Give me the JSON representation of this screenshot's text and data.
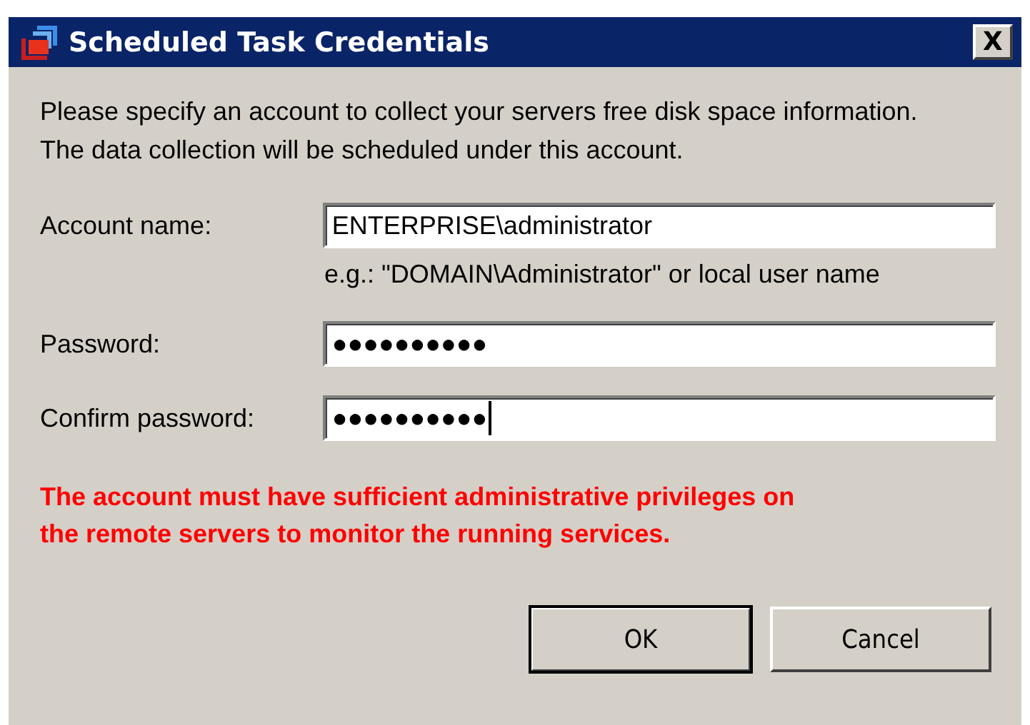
{
  "window": {
    "title": "Scheduled Task Credentials",
    "close": "X"
  },
  "intro": "Please specify an account to collect your servers free disk space information. The data collection will be scheduled under this account.",
  "fields": [
    {
      "label": "Account name:",
      "value": "ENTERPRISE\\administrator",
      "focused": false,
      "hint": "e.g.: \"DOMAIN\\Administrator\" or local user name"
    },
    {
      "label": "Password:",
      "value": "●●●●●●●●●●",
      "focused": false
    },
    {
      "label": "Confirm password:",
      "value": "●●●●●●●●●●",
      "focused": true
    }
  ],
  "warning": "The account must have sufficient administrative privileges on the remote servers to monitor the running services.",
  "buttons": [
    {
      "label": "OK",
      "default": true
    },
    {
      "label": "Cancel",
      "default": false
    }
  ]
}
